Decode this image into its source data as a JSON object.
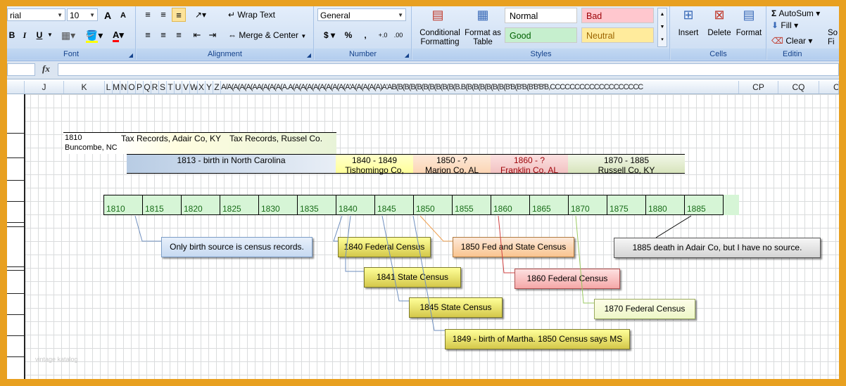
{
  "ribbon": {
    "font": {
      "name": "rial",
      "size": "10",
      "group_label": "Font",
      "grow": "A",
      "shrink": "A",
      "bold": "B",
      "italic": "I",
      "underline": "U"
    },
    "alignment": {
      "wrap_text": "Wrap Text",
      "merge_center": "Merge & Center",
      "group_label": "Alignment"
    },
    "number": {
      "format": "General",
      "currency": "$",
      "percent": "%",
      "comma": ",",
      "group_label": "Number"
    },
    "styles": {
      "conditional": "Conditional Formatting",
      "format_table": "Format as Table",
      "normal": "Normal",
      "bad": "Bad",
      "good": "Good",
      "neutral": "Neutral",
      "group_label": "Styles",
      "colors": {
        "normal": "#ffffff",
        "bad": "#ffc7ce",
        "good": "#c6efce",
        "neutral": "#ffeb9c",
        "bad_text": "#9c0006",
        "good_text": "#006100",
        "neutral_text": "#9c6500"
      }
    },
    "cells": {
      "insert": "Insert",
      "delete": "Delete",
      "format": "Format",
      "group_label": "Cells"
    },
    "editing": {
      "autosum": "AutoSum",
      "fill": "Fill",
      "clear": "Clear",
      "group_label": "Editin",
      "sort": "So",
      "find": "Fi"
    }
  },
  "formula_bar": {
    "fx": "fx",
    "value": ""
  },
  "columns": {
    "J": "J",
    "K": "K",
    "L": "L",
    "M": "M",
    "N": "N",
    "O": "O",
    "P": "P",
    "Q": "Q",
    "R": "R",
    "S": "S",
    "T": "T",
    "U": "U",
    "V": "V",
    "W": "W",
    "X": "X",
    "Y": "Y",
    "Z": "Z",
    "dense": "A/A(A(A(A(AA(A(A(A(A.A(A(A(A(A(A(A(A(A(A'A(A(A(A(A)A'AB(B(B(B(B(B(B(B(B(B(B.B(B(B(B(B(B(B(B'B(B'B(B'B'B'B,CCCCCCCCCCCCCCCCCCC",
    "CP": "CP",
    "CQ": "CQ",
    "CR": "C"
  },
  "sheet": {
    "row1": {
      "k": "1810",
      "k2": "Buncombe, NC",
      "tax_adair": "Tax Records, Adair Co, KY",
      "tax_russel": "Tax Records, Russel Co."
    },
    "bands": [
      {
        "line1": "1813 - birth in North Carolina",
        "line2": "",
        "bg": "#b8cce4"
      },
      {
        "line1": "1840 - 1849",
        "line2": "Tishomingo Co,",
        "bg": "#ffff99"
      },
      {
        "line1": "1850 - ?",
        "line2": "Marion Co, AL",
        "bg": "#fcd5b4"
      },
      {
        "line1": "1860 - ?",
        "line2": "Franklin Co, AL",
        "bg": "#f2b7b7"
      },
      {
        "line1": "1870 - 1885",
        "line2": "Russell Co, KY",
        "bg": "#d8e4bc"
      }
    ],
    "timeline": [
      "1810",
      "1815",
      "1820",
      "1825",
      "1830",
      "1835",
      "1840",
      "1845",
      "1850",
      "1855",
      "1860",
      "1865",
      "1870",
      "1875",
      "1880",
      "1885"
    ],
    "callouts": {
      "birth_source": "Only birth source is census records.",
      "c1840": "1840 Federal Census",
      "c1841": "1841 State Census",
      "c1845": "1845 State Census",
      "c1849": "1849 - birth of Martha. 1850 Census says MS",
      "c1850": "1850 Fed and State Census",
      "c1860": "1860 Federal Census",
      "c1870": "1870 Federal Census",
      "c1885": "1885 death in Adair Co, but I have no source."
    },
    "watermark": "vintage katalog"
  }
}
